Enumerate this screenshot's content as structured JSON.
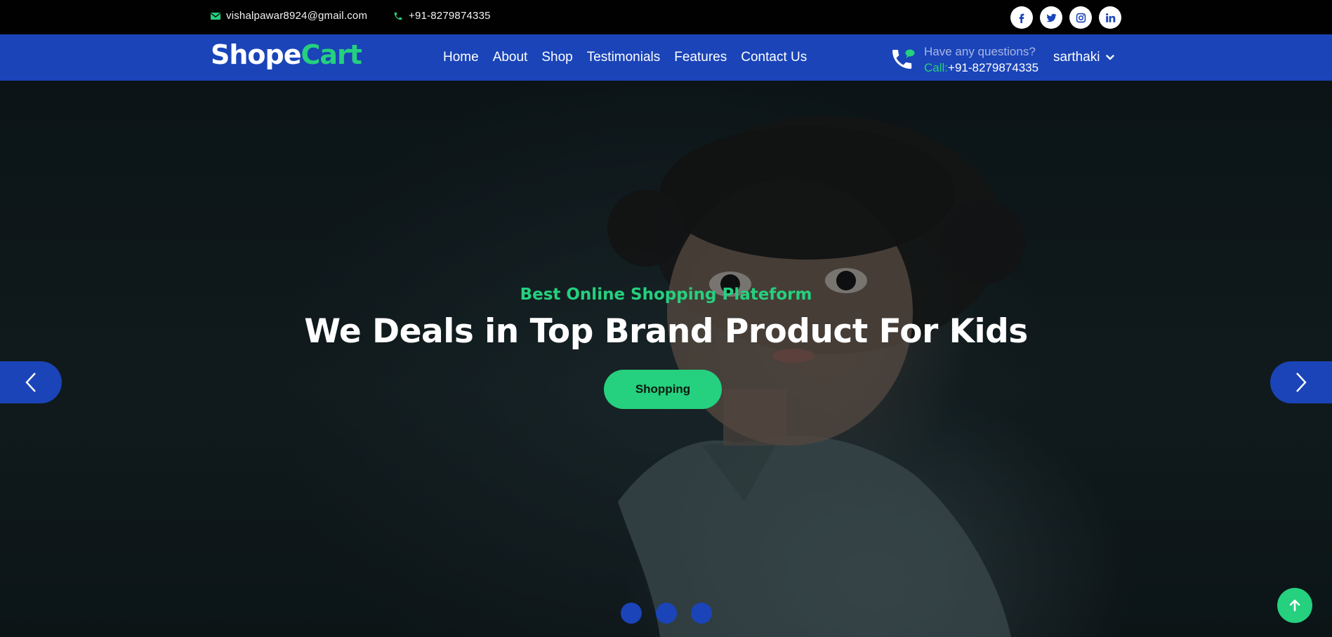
{
  "topbar": {
    "email": "vishalpawar8924@gmail.com",
    "phone": "+91-8279874335",
    "email_icon": "envelope-icon",
    "phone_icon": "phone-icon",
    "socials": [
      "facebook-icon",
      "twitter-icon",
      "instagram-icon",
      "linkedin-icon"
    ]
  },
  "navbar": {
    "logo_part1": "Shope",
    "logo_part2": "Cart",
    "menu": [
      "Home",
      "About",
      "Shop",
      "Testimonials",
      "Features",
      "Contact Us"
    ],
    "help_question": "Have any questions?",
    "help_call_label": "Call:",
    "help_call_number": "+91-8279874335",
    "user_name": "sarthaki"
  },
  "hero": {
    "subtitle": "Best Online Shopping Plateform",
    "title": "We Deals in Top Brand Product For Kids",
    "button_label": "Shopping",
    "slide_count": 3
  },
  "colors": {
    "primary": "#1a44b8",
    "accent": "#25d07e",
    "topbar": "#010101"
  }
}
